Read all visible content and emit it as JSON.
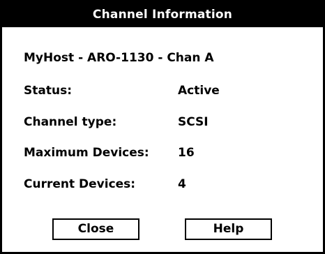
{
  "dialog": {
    "title": "Channel Information",
    "source": "MyHost - ARO-1130 - Chan A",
    "fields": [
      {
        "label": "Status:",
        "value": "Active"
      },
      {
        "label": "Channel type:",
        "value": "SCSI"
      },
      {
        "label": "Maximum Devices:",
        "value": "16"
      },
      {
        "label": "Current Devices:",
        "value": "4"
      }
    ],
    "buttons": {
      "close_label": "Close",
      "help_label": "Help"
    }
  }
}
